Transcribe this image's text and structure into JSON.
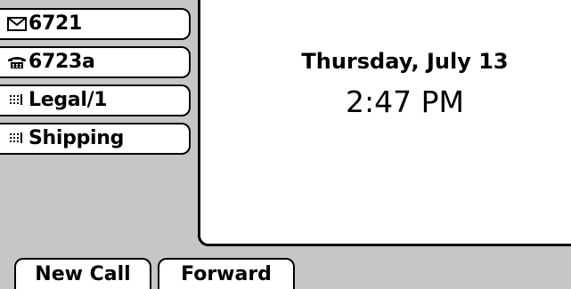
{
  "lines": [
    {
      "icon": "envelope-icon",
      "label": "6721"
    },
    {
      "icon": "phone-icon",
      "label": "6723a"
    },
    {
      "icon": "speed-dial-icon",
      "label": "Legal/1"
    },
    {
      "icon": "speed-dial-icon",
      "label": "Shipping"
    }
  ],
  "display": {
    "date": "Thursday, July 13",
    "time": "2:47 PM"
  },
  "softkeys": {
    "new_call": "New Call",
    "forward": "Forward"
  },
  "colors": {
    "screen_background": "#c6c6c6",
    "panel_background": "#ffffff",
    "ink": "#000000"
  }
}
